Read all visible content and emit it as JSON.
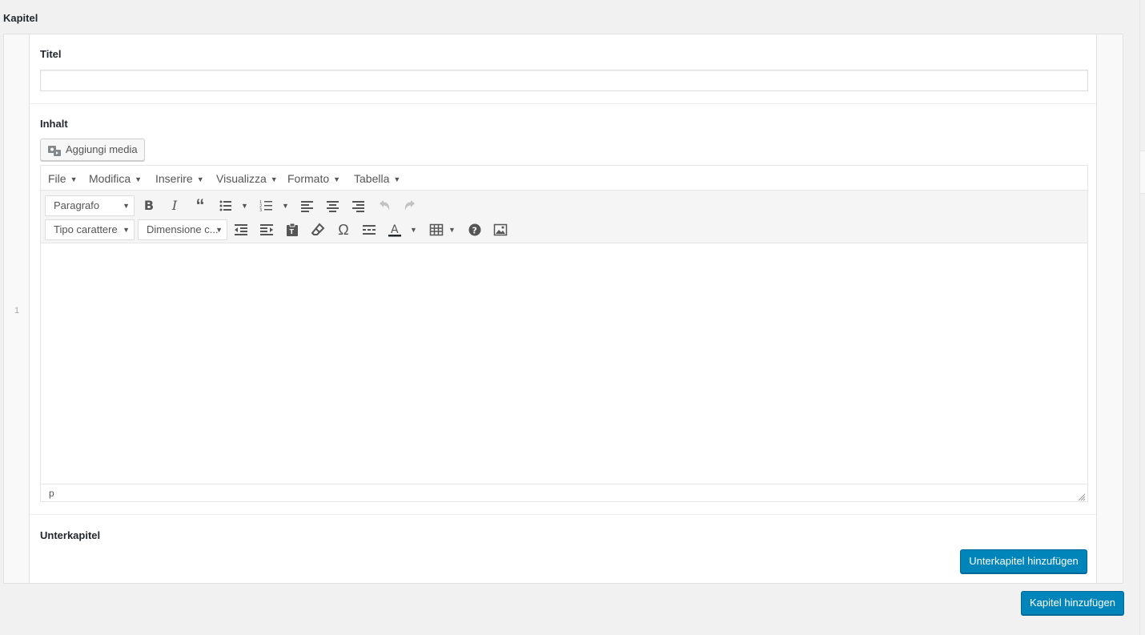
{
  "section": {
    "title": "Kapitel"
  },
  "row": {
    "number": "1"
  },
  "title_field": {
    "label": "Titel",
    "value": ""
  },
  "content_field": {
    "label": "Inhalt",
    "add_media_label": "Aggiungi media",
    "menu": [
      "File",
      "Modifica",
      "Inserire",
      "Visualizza",
      "Formato",
      "Tabella"
    ],
    "format_select": "Paragrafo",
    "font_family_select": "Tipo carattere",
    "font_size_select": "Dimensione c...",
    "status_path": "p"
  },
  "subchapter_field": {
    "label": "Unterkapitel",
    "add_button": "Unterkapitel hinzufügen"
  },
  "add_chapter_button": "Kapitel hinzufügen",
  "colors": {
    "primary": "#0085ba",
    "background": "#f1f1f1"
  }
}
